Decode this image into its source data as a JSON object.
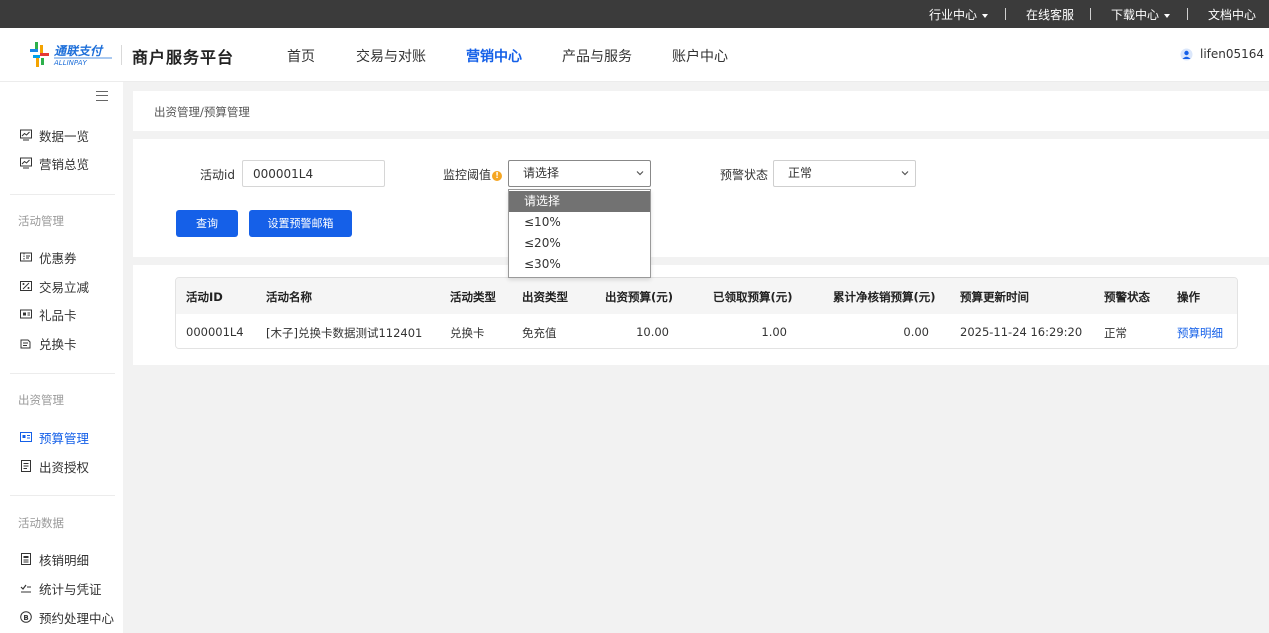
{
  "topbar": {
    "industry_center": "行业中心",
    "online_service": "在线客服",
    "download_center": "下载中心",
    "doc_center": "文档中心"
  },
  "header": {
    "logo_text": "通联支付",
    "logo_subtext": "ALLINPAY",
    "platform_title": "商户服务平台",
    "nav": [
      "首页",
      "交易与对账",
      "营销中心",
      "产品与服务",
      "账户中心"
    ],
    "active_nav": "营销中心",
    "username": "lifen05164"
  },
  "sidebar": {
    "top_items": [
      {
        "label": "数据一览",
        "icon": "chart-monitor-icon"
      },
      {
        "label": "营销总览",
        "icon": "chart-monitor-icon"
      }
    ],
    "groups": [
      {
        "title": "活动管理",
        "items": [
          {
            "label": "优惠券",
            "icon": "coupon-icon"
          },
          {
            "label": "交易立减",
            "icon": "discount-icon"
          },
          {
            "label": "礼品卡",
            "icon": "gift-card-icon"
          },
          {
            "label": "兑换卡",
            "icon": "exchange-card-icon"
          }
        ]
      },
      {
        "title": "出资管理",
        "items": [
          {
            "label": "预算管理",
            "icon": "budget-icon",
            "active": true
          },
          {
            "label": "出资授权",
            "icon": "document-icon"
          }
        ]
      },
      {
        "title": "活动数据",
        "items": [
          {
            "label": "核销明细",
            "icon": "ledger-icon"
          },
          {
            "label": "统计与凭证",
            "icon": "check-list-icon"
          },
          {
            "label": "预约处理中心",
            "icon": "coin-icon"
          }
        ]
      }
    ]
  },
  "breadcrumb": "出资管理/预算管理",
  "filters": {
    "activity_id_label": "活动id",
    "activity_id_value": "000001L4",
    "threshold_label": "监控阈值",
    "threshold_selected": "请选择",
    "threshold_options": [
      "请选择",
      "≤10%",
      "≤20%",
      "≤30%"
    ],
    "alert_status_label": "预警状态",
    "alert_status_value": "正常",
    "query_button": "查询",
    "set_email_button": "设置预警邮箱"
  },
  "table": {
    "columns": [
      "活动ID",
      "活动名称",
      "活动类型",
      "出资类型",
      "出资预算(元)",
      "已领取预算(元)",
      "累计净核销预算(元)",
      "预算更新时间",
      "预警状态",
      "操作"
    ],
    "rows": [
      [
        "000001L4",
        "[木子]兑换卡数据测试112401",
        "兑换卡",
        "免充值",
        "10.00",
        "1.00",
        "0.00",
        "2025-11-24 16:29:20",
        "正常",
        "预算明细"
      ]
    ]
  },
  "colors": {
    "accent": "#1560e8",
    "topbar_bg": "#3b3b3b",
    "dropdown_selected_bg": "#727272",
    "warning": "#f5a623"
  }
}
